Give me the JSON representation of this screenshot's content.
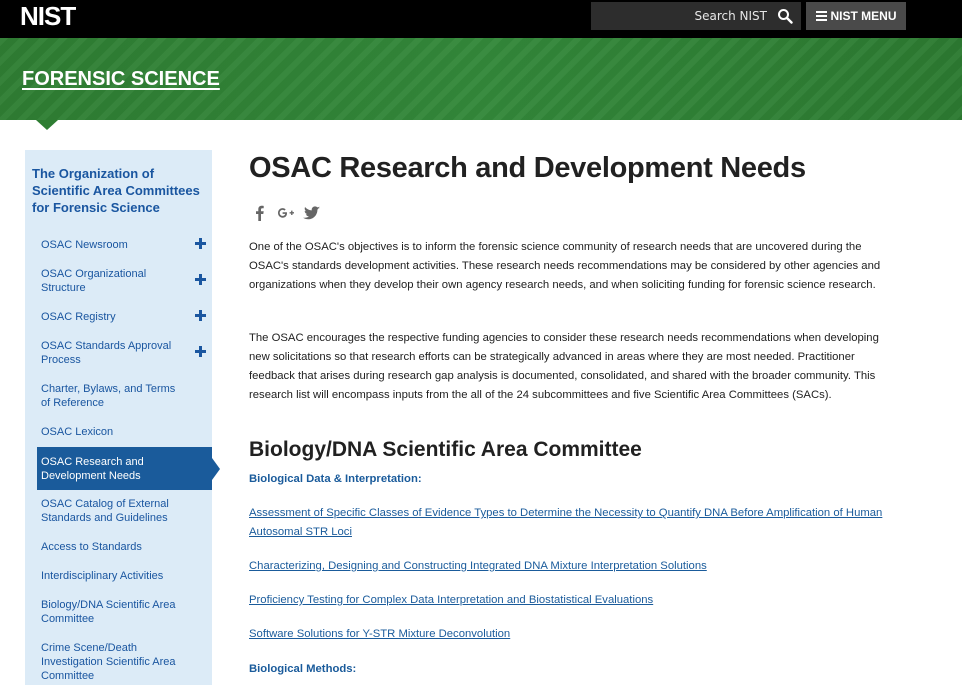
{
  "header": {
    "logo": "NIST",
    "search_placeholder": "Search NIST",
    "menu_label": "NIST MENU"
  },
  "banner": {
    "title": "FORENSIC SCIENCE"
  },
  "sidebar": {
    "title": "The Organization of Scientific Area Committees for Forensic Science",
    "items": [
      {
        "label": "OSAC Newsroom",
        "expandable": true
      },
      {
        "label": "OSAC Organizational Structure",
        "expandable": true
      },
      {
        "label": "OSAC Registry",
        "expandable": true
      },
      {
        "label": "OSAC Standards Approval Process",
        "expandable": true
      },
      {
        "label": "Charter, Bylaws, and Terms of Reference",
        "expandable": false
      },
      {
        "label": "OSAC Lexicon",
        "expandable": false
      },
      {
        "label": "OSAC Research and Development Needs",
        "expandable": false,
        "active": true
      },
      {
        "label": "OSAC Catalog of External Standards and Guidelines",
        "expandable": false
      },
      {
        "label": "Access to Standards",
        "expandable": false
      },
      {
        "label": "Interdisciplinary Activities",
        "expandable": false
      },
      {
        "label": "Biology/DNA Scientific Area Committee",
        "expandable": false
      },
      {
        "label": "Crime Scene/Death Investigation Scientific Area Committee",
        "expandable": false
      }
    ]
  },
  "main": {
    "title": "OSAC Research and Development Needs",
    "share_icons": [
      "facebook-icon",
      "google-plus-icon",
      "twitter-icon"
    ],
    "paragraphs": [
      "One of the OSAC's objectives is to inform the forensic science community of research needs that are uncovered during the OSAC's standards development activities. These research needs recommendations may be considered by other agencies and organizations when they develop their own agency research needs, and when soliciting funding for forensic science research.",
      "The OSAC encourages the respective funding agencies to consider these research needs recommendations when developing new solicitations so that research efforts can be strategically advanced in areas where they are most needed. Practitioner feedback that arises during research gap analysis is documented, consolidated, and shared with the broader community. This research list will encompass inputs from the all of the 24 subcommittees and five Scientific Area Committees (SACs)."
    ],
    "section_title": "Biology/DNA Scientific Area Committee",
    "subsections": [
      {
        "title": "Biological Data & Interpretation:",
        "links": [
          "Assessment of Specific Classes of Evidence Types to Determine the Necessity to Quantify DNA Before Amplification of Human Autosomal STR Loci",
          "Characterizing, Designing and Constructing Integrated DNA Mixture Interpretation Solutions",
          "Proficiency Testing for Complex Data Interpretation and Biostatistical Evaluations",
          "Software Solutions for Y-STR Mixture Deconvolution"
        ]
      },
      {
        "title": "Biological Methods:",
        "links": []
      }
    ]
  },
  "colors": {
    "header_bg": "#000000",
    "banner_green": "#2e7d32",
    "sidebar_bg": "#dcebf7",
    "link_blue": "#1a5b9b",
    "active_bg": "#1a5b9b"
  }
}
